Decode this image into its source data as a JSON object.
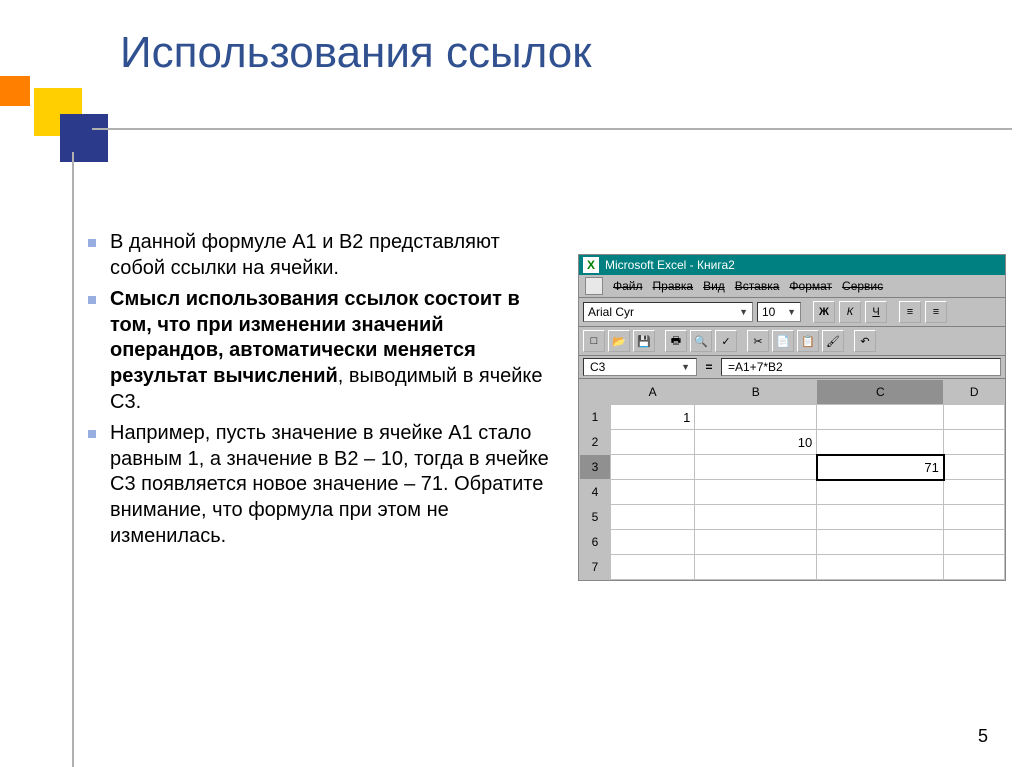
{
  "title": "Использования ссылок",
  "bullets": [
    {
      "parts": [
        {
          "b": false,
          "t": "В данной формуле А1 и В2 представляют собой ссылки на ячейки."
        }
      ]
    },
    {
      "parts": [
        {
          "b": true,
          "t": "Смысл использования ссылок состоит в том, что при изменении значений операндов, автоматически меняется результат вычислений"
        },
        {
          "b": false,
          "t": ", выводимый в ячейке С3."
        }
      ]
    },
    {
      "parts": [
        {
          "b": false,
          "t": "Например, пусть значение в ячейке А1 стало равным 1, а значение в В2 – 10, тогда в ячейке С3 появляется новое значение – 71. Обратите внимание, что формула при этом не изменилась."
        }
      ]
    }
  ],
  "page_number": "5",
  "excel": {
    "title": "Microsoft Excel - Книга2",
    "menus": [
      "Файл",
      "Правка",
      "Вид",
      "Вставка",
      "Формат",
      "Сервис"
    ],
    "font": "Arial Cyr",
    "font_size": "10",
    "style_btns": {
      "bold": "Ж",
      "italic": "К",
      "underline": "Ч"
    },
    "name_box": "C3",
    "formula": "=A1+7*B2",
    "columns": [
      "A",
      "B",
      "C",
      "D"
    ],
    "rows": [
      {
        "n": "1",
        "cells": {
          "A": "1"
        }
      },
      {
        "n": "2",
        "cells": {
          "B": "10"
        }
      },
      {
        "n": "3",
        "cells": {
          "C": "71"
        },
        "selected": true,
        "active": "C"
      },
      {
        "n": "4",
        "cells": {}
      },
      {
        "n": "5",
        "cells": {}
      },
      {
        "n": "6",
        "cells": {}
      },
      {
        "n": "7",
        "cells": {}
      }
    ]
  }
}
